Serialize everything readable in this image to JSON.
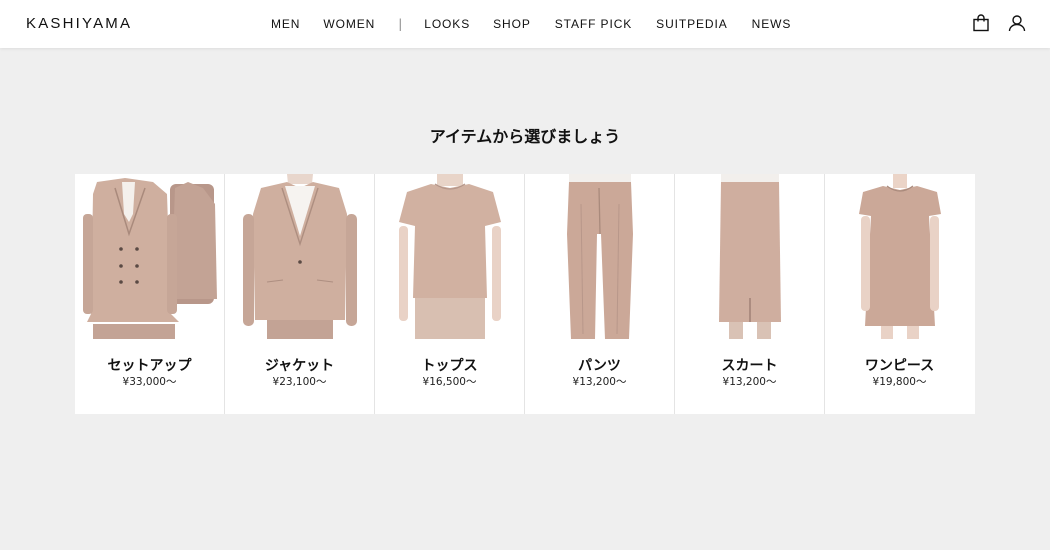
{
  "header": {
    "logo": "KASHIYAMA",
    "nav": [
      "MEN",
      "WOMEN",
      "LOOKS",
      "SHOP",
      "STAFF PICK",
      "SUITPEDIA",
      "NEWS"
    ],
    "separator": "|",
    "icons": [
      "shopping-bag-icon",
      "user-icon"
    ]
  },
  "main": {
    "title": "アイテムから選びましょう",
    "items": [
      {
        "name": "セットアップ",
        "price": "¥33,000～"
      },
      {
        "name": "ジャケット",
        "price": "¥23,100～"
      },
      {
        "name": "トップス",
        "price": "¥16,500～"
      },
      {
        "name": "パンツ",
        "price": "¥13,200～"
      },
      {
        "name": "スカート",
        "price": "¥13,200～"
      },
      {
        "name": "ワンピース",
        "price": "¥19,800～"
      }
    ]
  },
  "colors": {
    "background": "#efefef",
    "header": "#ffffff",
    "garment": "#c9a99a",
    "text": "#111111"
  }
}
